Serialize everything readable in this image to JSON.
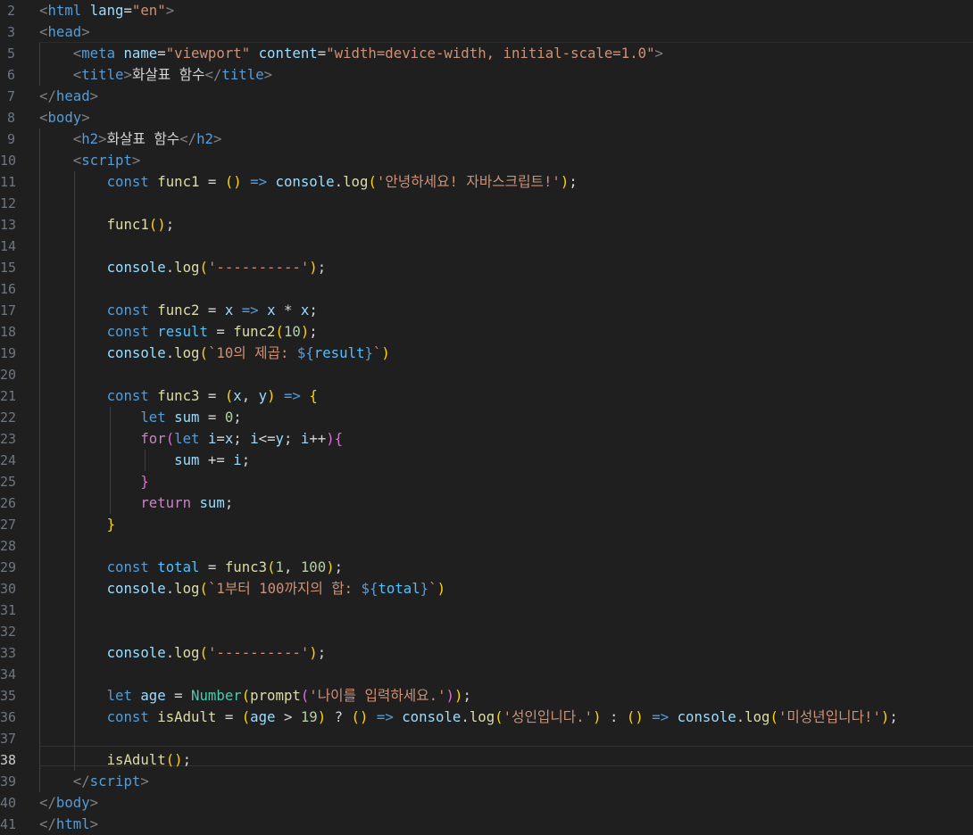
{
  "editor": {
    "active_line": "38",
    "lines": [
      {
        "num": "2",
        "tokens": [
          [
            "tag",
            "<"
          ],
          [
            "tn",
            "html"
          ],
          [
            "tx",
            " "
          ],
          [
            "at",
            "lang"
          ],
          [
            "tx",
            "="
          ],
          [
            "st",
            "\"en\""
          ],
          [
            "tag",
            ">"
          ]
        ]
      },
      {
        "num": "3",
        "tokens": [
          [
            "tag",
            "<"
          ],
          [
            "tn",
            "head"
          ],
          [
            "tag",
            ">"
          ]
        ]
      },
      {
        "num": "5",
        "tokens": [
          [
            "tx",
            "    "
          ],
          [
            "tag",
            "<"
          ],
          [
            "tn",
            "meta"
          ],
          [
            "tx",
            " "
          ],
          [
            "at",
            "name"
          ],
          [
            "tx",
            "="
          ],
          [
            "st",
            "\"viewport\""
          ],
          [
            "tx",
            " "
          ],
          [
            "at",
            "content"
          ],
          [
            "tx",
            "="
          ],
          [
            "st",
            "\"width=device-width, initial-scale=1.0\""
          ],
          [
            "tag",
            ">"
          ]
        ]
      },
      {
        "num": "6",
        "tokens": [
          [
            "tx",
            "    "
          ],
          [
            "tag",
            "<"
          ],
          [
            "tn",
            "title"
          ],
          [
            "tag",
            ">"
          ],
          [
            "tx",
            "화살표 함수"
          ],
          [
            "tag",
            "</"
          ],
          [
            "tn",
            "title"
          ],
          [
            "tag",
            ">"
          ]
        ]
      },
      {
        "num": "7",
        "tokens": [
          [
            "tag",
            "</"
          ],
          [
            "tn",
            "head"
          ],
          [
            "tag",
            ">"
          ]
        ]
      },
      {
        "num": "8",
        "tokens": [
          [
            "tag",
            "<"
          ],
          [
            "tn",
            "body"
          ],
          [
            "tag",
            ">"
          ]
        ]
      },
      {
        "num": "9",
        "tokens": [
          [
            "tx",
            "    "
          ],
          [
            "tag",
            "<"
          ],
          [
            "tn",
            "h2"
          ],
          [
            "tag",
            ">"
          ],
          [
            "tx",
            "화살표 함수"
          ],
          [
            "tag",
            "</"
          ],
          [
            "tn",
            "h2"
          ],
          [
            "tag",
            ">"
          ]
        ]
      },
      {
        "num": "10",
        "tokens": [
          [
            "tx",
            "    "
          ],
          [
            "tag",
            "<"
          ],
          [
            "tn",
            "script"
          ],
          [
            "tag",
            ">"
          ]
        ]
      },
      {
        "num": "11",
        "tokens": [
          [
            "tx",
            "        "
          ],
          [
            "kw",
            "const"
          ],
          [
            "tx",
            " "
          ],
          [
            "fn",
            "func1"
          ],
          [
            "tx",
            " = "
          ],
          [
            "p1",
            "()"
          ],
          [
            "tx",
            " "
          ],
          [
            "kw",
            "=>"
          ],
          [
            "tx",
            " "
          ],
          [
            "var",
            "console"
          ],
          [
            "tx",
            "."
          ],
          [
            "fn",
            "log"
          ],
          [
            "p1",
            "("
          ],
          [
            "st",
            "'안녕하세요! 자바스크립트!'"
          ],
          [
            "p1",
            ")"
          ],
          [
            "tx",
            ";"
          ]
        ]
      },
      {
        "num": "12",
        "tokens": []
      },
      {
        "num": "13",
        "tokens": [
          [
            "tx",
            "        "
          ],
          [
            "fn",
            "func1"
          ],
          [
            "p1",
            "()"
          ],
          [
            "tx",
            ";"
          ]
        ]
      },
      {
        "num": "14",
        "tokens": []
      },
      {
        "num": "15",
        "tokens": [
          [
            "tx",
            "        "
          ],
          [
            "var",
            "console"
          ],
          [
            "tx",
            "."
          ],
          [
            "fn",
            "log"
          ],
          [
            "p1",
            "("
          ],
          [
            "st",
            "'----------'"
          ],
          [
            "p1",
            ")"
          ],
          [
            "tx",
            ";"
          ]
        ]
      },
      {
        "num": "16",
        "tokens": []
      },
      {
        "num": "17",
        "tokens": [
          [
            "tx",
            "        "
          ],
          [
            "kw",
            "const"
          ],
          [
            "tx",
            " "
          ],
          [
            "fn",
            "func2"
          ],
          [
            "tx",
            " = "
          ],
          [
            "var",
            "x"
          ],
          [
            "tx",
            " "
          ],
          [
            "kw",
            "=>"
          ],
          [
            "tx",
            " "
          ],
          [
            "var",
            "x"
          ],
          [
            "tx",
            " * "
          ],
          [
            "var",
            "x"
          ],
          [
            "tx",
            ";"
          ]
        ]
      },
      {
        "num": "18",
        "tokens": [
          [
            "tx",
            "        "
          ],
          [
            "kw",
            "const"
          ],
          [
            "tx",
            " "
          ],
          [
            "cn",
            "result"
          ],
          [
            "tx",
            " = "
          ],
          [
            "fn",
            "func2"
          ],
          [
            "p1",
            "("
          ],
          [
            "num",
            "10"
          ],
          [
            "p1",
            ")"
          ],
          [
            "tx",
            ";"
          ]
        ]
      },
      {
        "num": "19",
        "tokens": [
          [
            "tx",
            "        "
          ],
          [
            "var",
            "console"
          ],
          [
            "tx",
            "."
          ],
          [
            "fn",
            "log"
          ],
          [
            "p1",
            "("
          ],
          [
            "st",
            "`10의 제곱: "
          ],
          [
            "kw",
            "${"
          ],
          [
            "cn",
            "result"
          ],
          [
            "kw",
            "}"
          ],
          [
            "st",
            "`"
          ],
          [
            "p1",
            ")"
          ]
        ]
      },
      {
        "num": "20",
        "tokens": []
      },
      {
        "num": "21",
        "tokens": [
          [
            "tx",
            "        "
          ],
          [
            "kw",
            "const"
          ],
          [
            "tx",
            " "
          ],
          [
            "fn",
            "func3"
          ],
          [
            "tx",
            " = "
          ],
          [
            "p1",
            "("
          ],
          [
            "var",
            "x"
          ],
          [
            "tx",
            ", "
          ],
          [
            "var",
            "y"
          ],
          [
            "p1",
            ")"
          ],
          [
            "tx",
            " "
          ],
          [
            "kw",
            "=>"
          ],
          [
            "tx",
            " "
          ],
          [
            "p1",
            "{"
          ]
        ]
      },
      {
        "num": "22",
        "tokens": [
          [
            "tx",
            "            "
          ],
          [
            "kw",
            "let"
          ],
          [
            "tx",
            " "
          ],
          [
            "var",
            "sum"
          ],
          [
            "tx",
            " = "
          ],
          [
            "num",
            "0"
          ],
          [
            "tx",
            ";"
          ]
        ]
      },
      {
        "num": "23",
        "tokens": [
          [
            "tx",
            "            "
          ],
          [
            "ctl",
            "for"
          ],
          [
            "p2",
            "("
          ],
          [
            "kw",
            "let"
          ],
          [
            "tx",
            " "
          ],
          [
            "var",
            "i"
          ],
          [
            "tx",
            "="
          ],
          [
            "var",
            "x"
          ],
          [
            "tx",
            "; "
          ],
          [
            "var",
            "i"
          ],
          [
            "tx",
            "<="
          ],
          [
            "var",
            "y"
          ],
          [
            "tx",
            "; "
          ],
          [
            "var",
            "i"
          ],
          [
            "tx",
            "++"
          ],
          [
            "p2",
            ")"
          ],
          [
            "p2",
            "{"
          ]
        ]
      },
      {
        "num": "24",
        "tokens": [
          [
            "tx",
            "                "
          ],
          [
            "var",
            "sum"
          ],
          [
            "tx",
            " += "
          ],
          [
            "var",
            "i"
          ],
          [
            "tx",
            ";"
          ]
        ]
      },
      {
        "num": "25",
        "tokens": [
          [
            "tx",
            "            "
          ],
          [
            "p2",
            "}"
          ]
        ]
      },
      {
        "num": "26",
        "tokens": [
          [
            "tx",
            "            "
          ],
          [
            "ctl",
            "return"
          ],
          [
            "tx",
            " "
          ],
          [
            "var",
            "sum"
          ],
          [
            "tx",
            ";"
          ]
        ]
      },
      {
        "num": "27",
        "tokens": [
          [
            "tx",
            "        "
          ],
          [
            "p1",
            "}"
          ]
        ]
      },
      {
        "num": "28",
        "tokens": []
      },
      {
        "num": "29",
        "tokens": [
          [
            "tx",
            "        "
          ],
          [
            "kw",
            "const"
          ],
          [
            "tx",
            " "
          ],
          [
            "cn",
            "total"
          ],
          [
            "tx",
            " = "
          ],
          [
            "fn",
            "func3"
          ],
          [
            "p1",
            "("
          ],
          [
            "num",
            "1"
          ],
          [
            "tx",
            ", "
          ],
          [
            "num",
            "100"
          ],
          [
            "p1",
            ")"
          ],
          [
            "tx",
            ";"
          ]
        ]
      },
      {
        "num": "30",
        "tokens": [
          [
            "tx",
            "        "
          ],
          [
            "var",
            "console"
          ],
          [
            "tx",
            "."
          ],
          [
            "fn",
            "log"
          ],
          [
            "p1",
            "("
          ],
          [
            "st",
            "`1부터 100까지의 합: "
          ],
          [
            "kw",
            "${"
          ],
          [
            "cn",
            "total"
          ],
          [
            "kw",
            "}"
          ],
          [
            "st",
            "`"
          ],
          [
            "p1",
            ")"
          ]
        ]
      },
      {
        "num": "31",
        "tokens": []
      },
      {
        "num": "32",
        "tokens": []
      },
      {
        "num": "33",
        "tokens": [
          [
            "tx",
            "        "
          ],
          [
            "var",
            "console"
          ],
          [
            "tx",
            "."
          ],
          [
            "fn",
            "log"
          ],
          [
            "p1",
            "("
          ],
          [
            "st",
            "'----------'"
          ],
          [
            "p1",
            ")"
          ],
          [
            "tx",
            ";"
          ]
        ]
      },
      {
        "num": "34",
        "tokens": []
      },
      {
        "num": "35",
        "tokens": [
          [
            "tx",
            "        "
          ],
          [
            "kw",
            "let"
          ],
          [
            "tx",
            " "
          ],
          [
            "var",
            "age"
          ],
          [
            "tx",
            " = "
          ],
          [
            "cls",
            "Number"
          ],
          [
            "p1",
            "("
          ],
          [
            "fn",
            "prompt"
          ],
          [
            "p2",
            "("
          ],
          [
            "st",
            "'나이를 입력하세요.'"
          ],
          [
            "p2",
            ")"
          ],
          [
            "p1",
            ")"
          ],
          [
            "tx",
            ";"
          ]
        ]
      },
      {
        "num": "36",
        "tokens": [
          [
            "tx",
            "        "
          ],
          [
            "kw",
            "const"
          ],
          [
            "tx",
            " "
          ],
          [
            "fn",
            "isAdult"
          ],
          [
            "tx",
            " = "
          ],
          [
            "p1",
            "("
          ],
          [
            "var",
            "age"
          ],
          [
            "tx",
            " > "
          ],
          [
            "num",
            "19"
          ],
          [
            "p1",
            ")"
          ],
          [
            "tx",
            " ? "
          ],
          [
            "p1",
            "()"
          ],
          [
            "tx",
            " "
          ],
          [
            "kw",
            "=>"
          ],
          [
            "tx",
            " "
          ],
          [
            "var",
            "console"
          ],
          [
            "tx",
            "."
          ],
          [
            "fn",
            "log"
          ],
          [
            "p1",
            "("
          ],
          [
            "st",
            "'성인입니다.'"
          ],
          [
            "p1",
            ")"
          ],
          [
            "tx",
            " : "
          ],
          [
            "p1",
            "()"
          ],
          [
            "tx",
            " "
          ],
          [
            "kw",
            "=>"
          ],
          [
            "tx",
            " "
          ],
          [
            "var",
            "console"
          ],
          [
            "tx",
            "."
          ],
          [
            "fn",
            "log"
          ],
          [
            "p1",
            "("
          ],
          [
            "st",
            "'미성년입니다!'"
          ],
          [
            "p1",
            ")"
          ],
          [
            "tx",
            ";"
          ]
        ]
      },
      {
        "num": "37",
        "tokens": []
      },
      {
        "num": "38",
        "tokens": [
          [
            "tx",
            "        "
          ],
          [
            "fn",
            "isAdult"
          ],
          [
            "p1",
            "()"
          ],
          [
            "tx",
            ";"
          ]
        ]
      },
      {
        "num": "39",
        "tokens": [
          [
            "tx",
            "    "
          ],
          [
            "tag",
            "</"
          ],
          [
            "tn",
            "script"
          ],
          [
            "tag",
            ">"
          ]
        ]
      },
      {
        "num": "40",
        "tokens": [
          [
            "tag",
            "</"
          ],
          [
            "tn",
            "body"
          ],
          [
            "tag",
            ">"
          ]
        ]
      },
      {
        "num": "41",
        "tokens": [
          [
            "tag",
            "</"
          ],
          [
            "tn",
            "html"
          ],
          [
            "tag",
            ">"
          ]
        ]
      }
    ]
  }
}
